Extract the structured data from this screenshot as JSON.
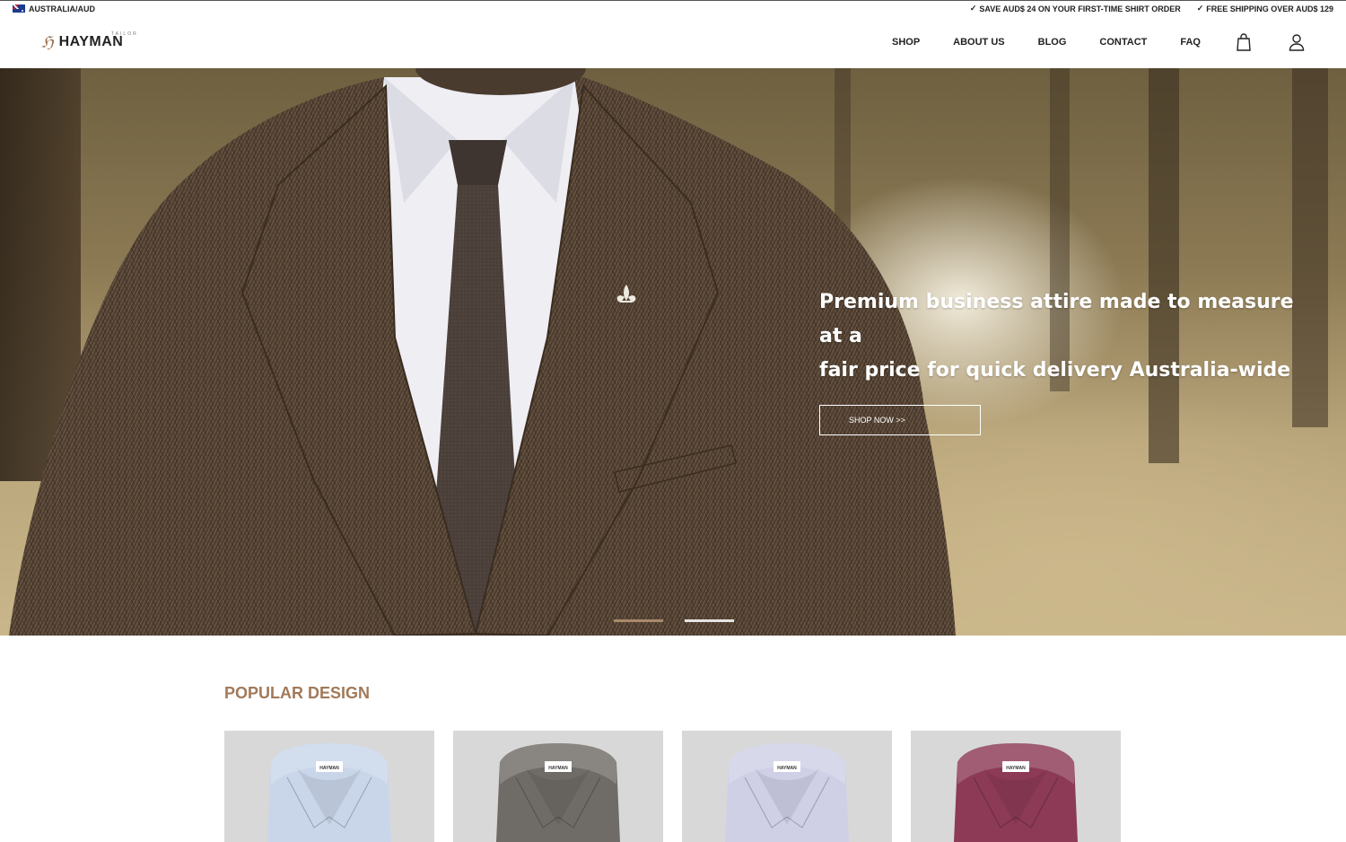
{
  "topbar": {
    "locale": "AUSTRALIA/AUD",
    "promos": [
      "SAVE AUD$ 24 ON YOUR FIRST-TIME SHIRT ORDER",
      "FREE SHIPPING OVER AUD$ 129"
    ]
  },
  "header": {
    "logo": "HAYMAN",
    "logo_sub": "TAILOR",
    "nav": [
      "SHOP",
      "ABOUT US",
      "BLOG",
      "CONTACT",
      "FAQ"
    ],
    "icons": [
      "shopping-bag-icon",
      "user-icon"
    ]
  },
  "hero": {
    "headline_line1": "Premium business attire made to measure at a",
    "headline_line2": "fair price for quick delivery Australia-wide",
    "cta": "SHOP NOW >>",
    "slides_total": 2,
    "slide_active": 1
  },
  "popular": {
    "title": "POPULAR DESIGN",
    "items": [
      {
        "color": "#c9d6ea",
        "label": "HAYMAN"
      },
      {
        "color": "#6f6b66",
        "label": "HAYMAN"
      },
      {
        "color": "#cfd0e6",
        "label": "HAYMAN"
      },
      {
        "color": "#8c3a55",
        "label": "HAYMAN"
      }
    ]
  },
  "colors": {
    "accent": "#a37958",
    "cta_border": "#ffffff",
    "hero_text": "#ffffff"
  }
}
